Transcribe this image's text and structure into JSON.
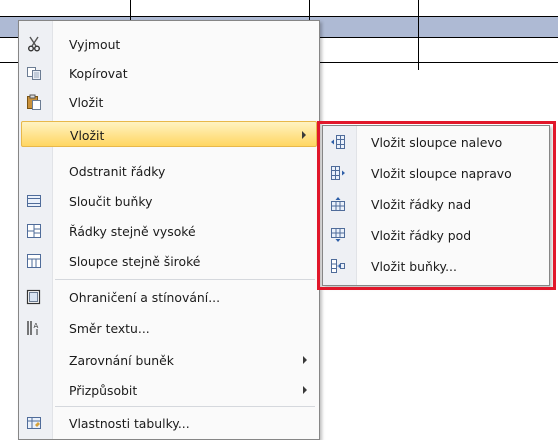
{
  "main_menu": {
    "items": [
      {
        "id": "cut",
        "label": "Vyjmout",
        "icon": "scissors-icon"
      },
      {
        "id": "copy",
        "label": "Kopírovat",
        "icon": "copy-icon"
      },
      {
        "id": "paste",
        "label": "Vložit",
        "icon": "paste-icon"
      },
      {
        "id": "insert",
        "label": "Vložit",
        "submenu": true,
        "highlighted": true
      },
      {
        "id": "delete-rows",
        "label": "Odstranit řádky"
      },
      {
        "id": "merge-cells",
        "label": "Sloučit buňky",
        "icon": "merge-cells-icon"
      },
      {
        "id": "distribute-rows",
        "label": "Řádky stejně vysoké",
        "icon": "distribute-rows-icon"
      },
      {
        "id": "distribute-cols",
        "label": "Sloupce stejně široké",
        "icon": "distribute-columns-icon"
      },
      {
        "id": "borders",
        "label": "Ohraničení a stínování...",
        "icon": "borders-icon"
      },
      {
        "id": "text-direction",
        "label": "Směr textu...",
        "icon": "text-direction-icon"
      },
      {
        "id": "cell-alignment",
        "label": "Zarovnání buněk",
        "submenu": true
      },
      {
        "id": "autofit",
        "label": "Přizpůsobit",
        "submenu": true
      },
      {
        "id": "table-properties",
        "label": "Vlastnosti tabulky...",
        "icon": "table-properties-icon"
      }
    ]
  },
  "sub_menu": {
    "items": [
      {
        "id": "insert-cols-left",
        "label": "Vložit sloupce nalevo",
        "icon": "insert-columns-left-icon"
      },
      {
        "id": "insert-cols-right",
        "label": "Vložit sloupce napravo",
        "icon": "insert-columns-right-icon"
      },
      {
        "id": "insert-rows-above",
        "label": "Vložit řádky nad",
        "icon": "insert-rows-above-icon"
      },
      {
        "id": "insert-rows-below",
        "label": "Vložit řádky pod",
        "icon": "insert-rows-below-icon"
      },
      {
        "id": "insert-cells",
        "label": "Vložit buňky...",
        "icon": "insert-cells-icon"
      }
    ]
  },
  "colors": {
    "highlight": "#ffd662",
    "selection_row": "#aebad4",
    "annotation_frame": "#e1172a"
  }
}
